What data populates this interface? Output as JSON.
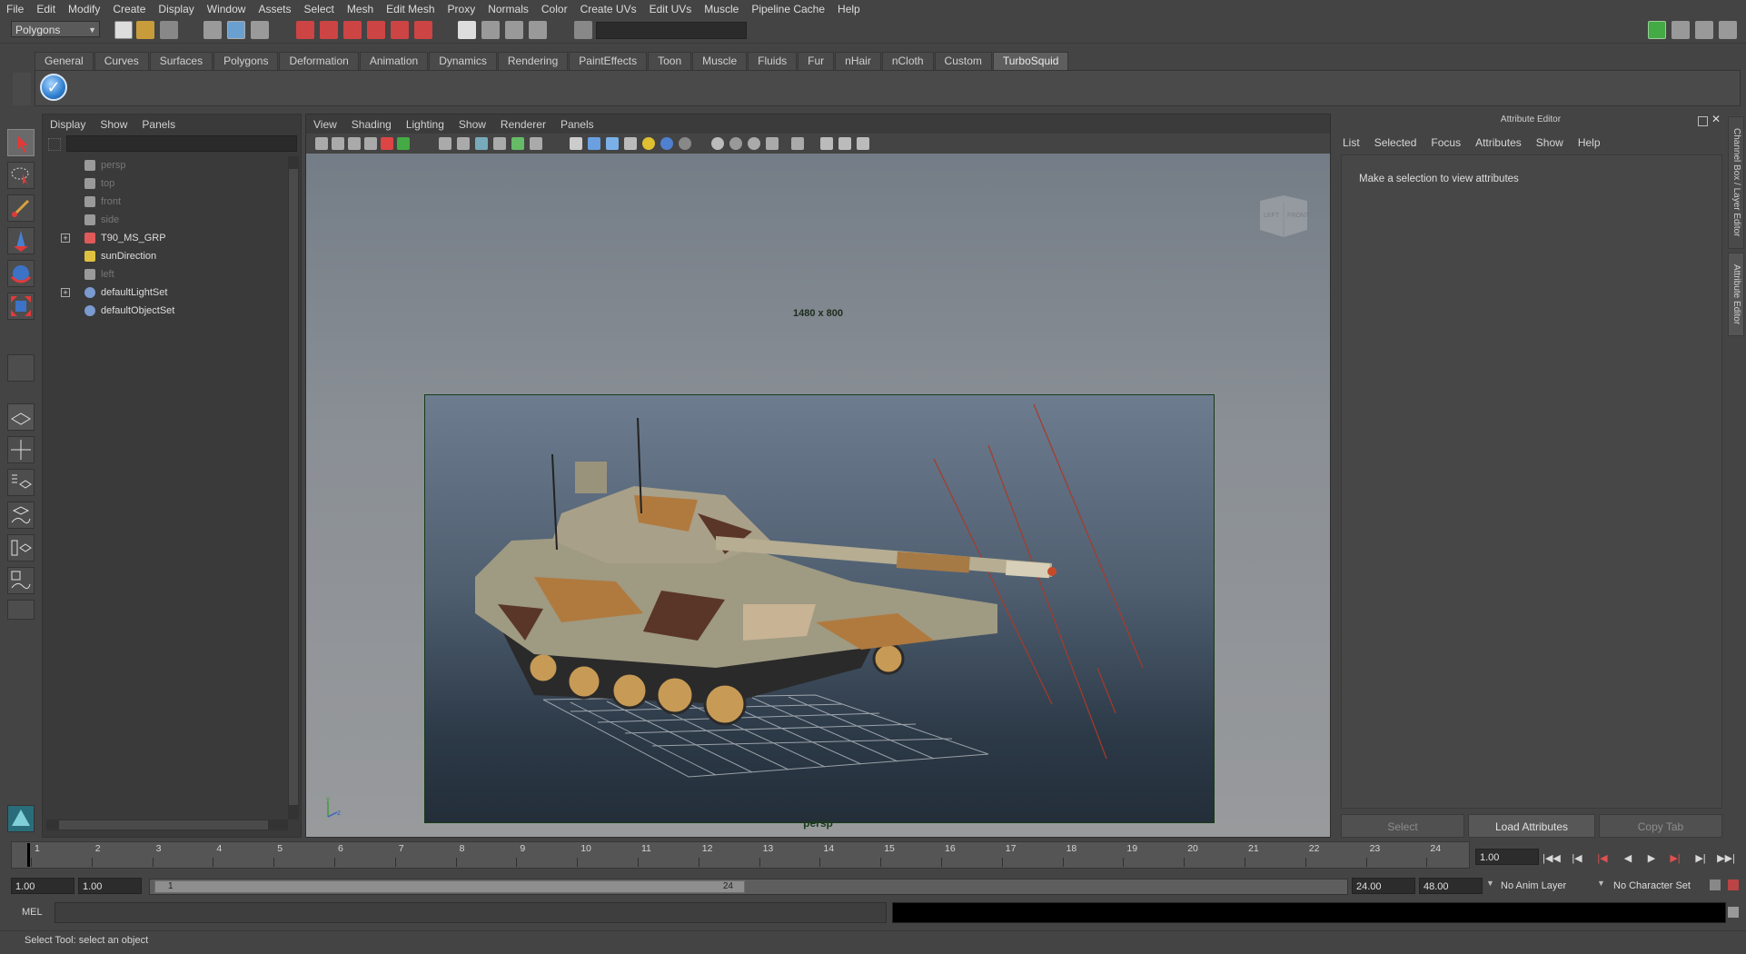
{
  "menu": [
    "File",
    "Edit",
    "Modify",
    "Create",
    "Display",
    "Window",
    "Assets",
    "Select",
    "Mesh",
    "Edit Mesh",
    "Proxy",
    "Normals",
    "Color",
    "Create UVs",
    "Edit UVs",
    "Muscle",
    "Pipeline Cache",
    "Help"
  ],
  "status_line": {
    "mode": "Polygons"
  },
  "shelf": {
    "tabs": [
      "General",
      "Curves",
      "Surfaces",
      "Polygons",
      "Deformation",
      "Animation",
      "Dynamics",
      "Rendering",
      "PaintEffects",
      "Toon",
      "Muscle",
      "Fluids",
      "Fur",
      "nHair",
      "nCloth",
      "Custom",
      "TurboSquid"
    ],
    "active_tab": "TurboSquid"
  },
  "outliner": {
    "menu": [
      "Display",
      "Show",
      "Panels"
    ],
    "items": [
      {
        "label": "persp",
        "dim": true,
        "expandable": false,
        "icon": "camera-icon"
      },
      {
        "label": "top",
        "dim": true,
        "expandable": false,
        "icon": "camera-icon"
      },
      {
        "label": "front",
        "dim": true,
        "expandable": false,
        "icon": "camera-icon"
      },
      {
        "label": "side",
        "dim": true,
        "expandable": false,
        "icon": "camera-icon"
      },
      {
        "label": "T90_MS_GRP",
        "dim": false,
        "expandable": true,
        "icon": "transform-icon"
      },
      {
        "label": "sunDirection",
        "dim": false,
        "expandable": false,
        "icon": "light-icon"
      },
      {
        "label": "left",
        "dim": true,
        "expandable": false,
        "icon": "camera-icon"
      },
      {
        "label": "defaultLightSet",
        "dim": false,
        "expandable": true,
        "icon": "set-icon"
      },
      {
        "label": "defaultObjectSet",
        "dim": false,
        "expandable": false,
        "icon": "set-icon"
      }
    ]
  },
  "viewport": {
    "menu": [
      "View",
      "Shading",
      "Lighting",
      "Show",
      "Renderer",
      "Panels"
    ],
    "resolution": "1480 x 800",
    "camera": "persp",
    "viewcube_left": "LEFT",
    "viewcube_front": "FRONT"
  },
  "attribute_editor": {
    "title": "Attribute Editor",
    "menu": [
      "List",
      "Selected",
      "Focus",
      "Attributes",
      "Show",
      "Help"
    ],
    "message": "Make a selection to view attributes",
    "buttons": {
      "select": "Select",
      "load": "Load Attributes",
      "copy": "Copy Tab"
    },
    "side_tabs": {
      "channel": "Channel Box / Layer Editor",
      "attribute": "Attribute Editor"
    }
  },
  "time_slider": {
    "frames": [
      "1",
      "2",
      "3",
      "4",
      "5",
      "6",
      "7",
      "8",
      "9",
      "10",
      "11",
      "12",
      "13",
      "14",
      "15",
      "16",
      "17",
      "18",
      "19",
      "20",
      "21",
      "22",
      "23",
      "24"
    ],
    "current_time": "1.00"
  },
  "range_slider": {
    "start_time": "1.00",
    "playback_start": "1.00",
    "range_start_label": "1",
    "range_end_label": "24",
    "playback_end": "24.00",
    "end_time": "48.00",
    "anim_layer": "No Anim Layer",
    "character_set": "No Character Set"
  },
  "command_line": {
    "label": "MEL"
  },
  "help_line": "Select Tool: select an object",
  "colors": {
    "ui_bg": "#444444",
    "panel_bg": "#3a3a3a",
    "gate_border": "#173a17",
    "label_green": "#1c3a1c"
  }
}
